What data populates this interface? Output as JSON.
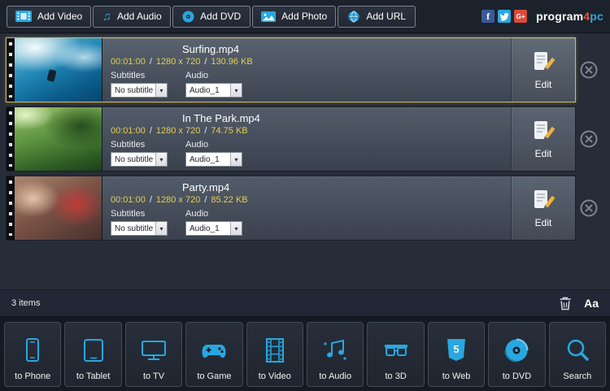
{
  "brand": {
    "part1": "program",
    "part2": "4",
    "part3": "pc"
  },
  "toolbar": {
    "buttons": [
      {
        "label": "Add Video",
        "icon": "film-icon"
      },
      {
        "label": "Add Audio",
        "icon": "music-note-icon"
      },
      {
        "label": "Add DVD",
        "icon": "disc-icon"
      },
      {
        "label": "Add Photo",
        "icon": "photo-icon"
      },
      {
        "label": "Add URL",
        "icon": "globe-www-icon"
      }
    ],
    "social": [
      "facebook",
      "twitter",
      "google-plus"
    ]
  },
  "labels": {
    "subtitles": "Subtitles",
    "audio": "Audio",
    "edit": "Edit",
    "sep": "/"
  },
  "items": [
    {
      "title": "Surfing.mp4",
      "duration": "00:01:00",
      "resolution": "1280 x 720",
      "size": "130.96 KB",
      "subtitle": "No subtitle",
      "audio_track": "Audio_1",
      "selected": true
    },
    {
      "title": "In The Park.mp4",
      "duration": "00:01:00",
      "resolution": "1280 x 720",
      "size": "74.75 KB",
      "subtitle": "No subtitle",
      "audio_track": "Audio_1",
      "selected": false
    },
    {
      "title": "Party.mp4",
      "duration": "00:01:00",
      "resolution": "1280 x 720",
      "size": "85.22 KB",
      "subtitle": "No subtitle",
      "audio_track": "Audio_1",
      "selected": false
    }
  ],
  "statusbar": {
    "count": "3 items",
    "font_button": "Aa"
  },
  "outputs": [
    {
      "label": "to Phone",
      "icon": "phone-icon"
    },
    {
      "label": "to Tablet",
      "icon": "tablet-icon"
    },
    {
      "label": "to TV",
      "icon": "tv-icon"
    },
    {
      "label": "to Game",
      "icon": "gamepad-icon"
    },
    {
      "label": "to Video",
      "icon": "filmstrip-icon"
    },
    {
      "label": "to Audio",
      "icon": "music-notes-icon"
    },
    {
      "label": "to 3D",
      "icon": "3d-glasses-icon"
    },
    {
      "label": "to Web",
      "icon": "html5-icon"
    },
    {
      "label": "to DVD",
      "icon": "dvd-disc-icon"
    },
    {
      "label": "Search",
      "icon": "search-icon"
    }
  ],
  "colors": {
    "accent": "#29a7e0",
    "meta_text": "#e3cf52",
    "selected_border": "#cdb961"
  }
}
